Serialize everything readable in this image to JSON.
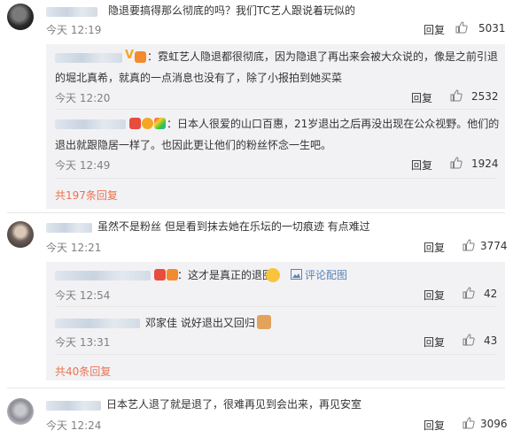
{
  "c1": {
    "text": "隐退要搞得那么彻底的吗？我们TC艺人跟说着玩似的",
    "time": "今天 12:19",
    "reply": "回复",
    "likes": "5031",
    "subs": [
      {
        "badge_v": "V",
        "text": "：霓虹艺人隐退都很彻底，因为隐退了再出来会被大众说的，像是之前引退的堀北真希，就真的一点消息也没有了，除了小报拍到她买菜",
        "line1": "：霓虹艺人隐退都很彻底，因为隐退了再出来会被大众说的，像是之前引退",
        "line2": "的堀北真希，就真的一点消息也没有了，除了小报拍到她买菜",
        "time": "今天 12:20",
        "reply": "回复",
        "likes": "2532"
      },
      {
        "line1": "：日本人很爱的山口百惠，21岁退出之后再没出现在公众视野。他们的",
        "line2": "退出就跟隐居一样了。也因此更让他们的粉丝怀念一生吧。",
        "time": "今天 12:49",
        "reply": "回复",
        "likes": "1924"
      }
    ],
    "more": "共197条回复"
  },
  "c2": {
    "text": "虽然不是粉丝 但是看到抹去她在乐坛的一切痕迹  有点难过",
    "time": "今天 12:21",
    "reply": "回复",
    "likes": "3774",
    "subs": [
      {
        "text": "：这才是真正的退圈",
        "link": "评论配图",
        "time": "今天 12:54",
        "reply": "回复",
        "likes": "42"
      },
      {
        "text": "邓家佳 说好退出又回归",
        "time": "今天 13:31",
        "reply": "回复",
        "likes": "43"
      }
    ],
    "more": "共40条回复"
  },
  "c3": {
    "text": "日本艺人退了就是退了，很难再见到会出来，再见安室",
    "time": "今天 12:24",
    "reply": "回复",
    "likes": "3096"
  },
  "colors": {
    "accent": "#eb7350",
    "link": "#5b83b6",
    "subbg": "#f2f2f5"
  }
}
